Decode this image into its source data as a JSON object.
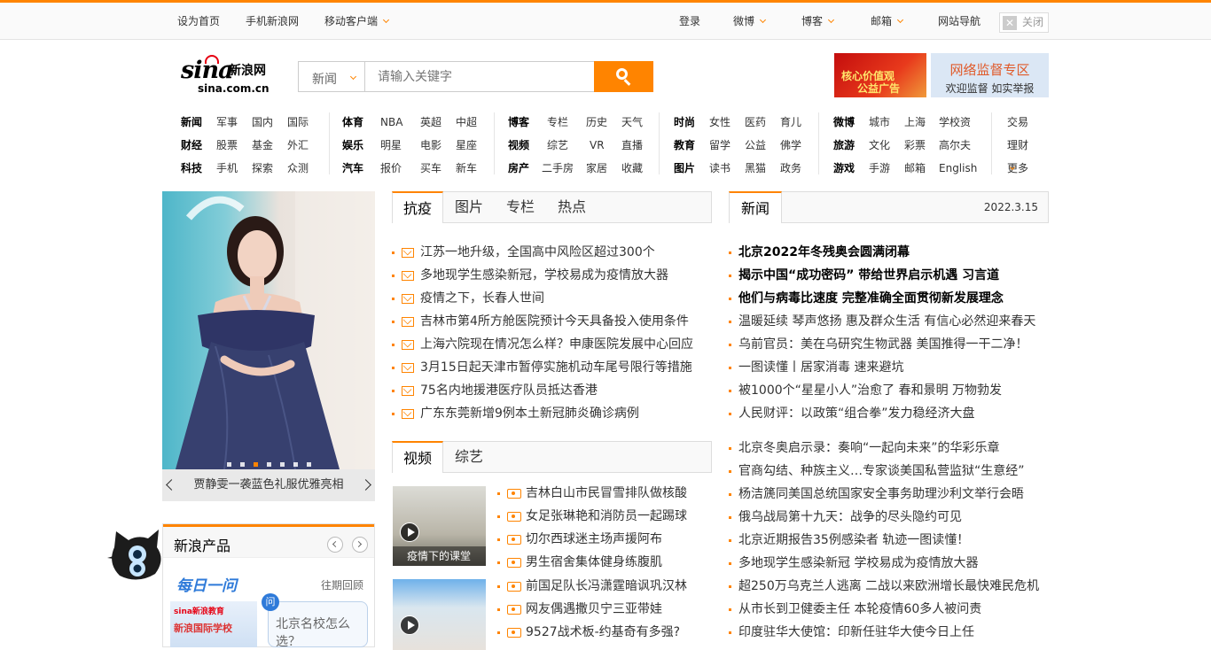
{
  "topbar": {
    "set_home": "设为首页",
    "mobile_sina": "手机新浪网",
    "mobile_client": "移动客户端",
    "login": "登录",
    "weibo": "微博",
    "blog": "博客",
    "mail": "邮箱",
    "site_nav": "网站导航",
    "close": "关闭"
  },
  "logo": {
    "brand": "sina",
    "cn": "新浪网",
    "domain": "sina.com.cn"
  },
  "search": {
    "category": "新闻",
    "placeholder": "请输入关键字"
  },
  "ads": {
    "left_line1": "核心价值观",
    "left_line2": "公益广告",
    "right_title": "网络监督专区",
    "right_sub": "欢迎监督 如实举报"
  },
  "nav": {
    "g1": [
      [
        "新闻",
        "军事",
        "国内",
        "国际"
      ],
      [
        "财经",
        "股票",
        "基金",
        "外汇"
      ],
      [
        "科技",
        "手机",
        "探索",
        "众测"
      ]
    ],
    "g2": [
      [
        "体育",
        "NBA",
        "英超",
        "中超"
      ],
      [
        "娱乐",
        "明星",
        "电影",
        "星座"
      ],
      [
        "汽车",
        "报价",
        "买车",
        "新车"
      ]
    ],
    "g3": [
      [
        "博客",
        "专栏",
        "历史",
        "天气"
      ],
      [
        "视频",
        "综艺",
        "VR",
        "直播"
      ],
      [
        "房产",
        "二手房",
        "家居",
        "收藏"
      ]
    ],
    "g4": [
      [
        "时尚",
        "女性",
        "医药",
        "育儿"
      ],
      [
        "教育",
        "留学",
        "公益",
        "佛学"
      ],
      [
        "图片",
        "读书",
        "黑猫",
        "政务"
      ]
    ],
    "g5": [
      [
        "微博",
        "城市",
        "上海",
        "学校资"
      ],
      [
        "旅游",
        "文化",
        "彩票",
        "高尔夫"
      ],
      [
        "游戏",
        "手游",
        "邮箱",
        "English"
      ]
    ],
    "g6": [
      "交易",
      "理财",
      "更多"
    ]
  },
  "slide": {
    "caption": "贾静雯一袭蓝色礼服优雅亮相"
  },
  "products": {
    "title": "新浪产品",
    "daily": "每日一问",
    "past": "往期回顾",
    "thumb_logo": "sina新浪教育",
    "thumb_title": "新浪国际学校",
    "question_badge": "问",
    "question": "北京名校怎么选？"
  },
  "tabs1": [
    "抗疫",
    "图片",
    "专栏",
    "热点"
  ],
  "news1": [
    "江苏一地升级，全国高中风险区超过300个",
    "多地现学生感染新冠，学校易成为疫情放大器",
    "疫情之下，长春人世间",
    "吉林市第4所方舱医院预计今天具备投入使用条件",
    "上海六院现在情况怎么样？申康医院发展中心回应",
    "3月15日起天津市暂停实施机动车尾号限行等措施",
    "75名内地援港医疗队员抵达香港",
    "广东东莞新增9例本土新冠肺炎确诊病例"
  ],
  "tabs2": [
    "视频",
    "综艺"
  ],
  "video_thumbs": [
    {
      "caption": "疫情下的课堂"
    },
    {
      "caption": ""
    }
  ],
  "videos": [
    "吉林白山市民冒雪排队做核酸",
    "女足张琳艳和消防员一起踢球",
    "切尔西球迷主场声援阿布",
    "男生宿舍集体健身练腹肌",
    "前国足队长冯潇霆暗讽巩汉林",
    "网友偶遇撒贝宁三亚带娃",
    "9527战术板-约基奇有多强?"
  ],
  "right": {
    "tab": "新闻",
    "date": "2022.3.15",
    "headlines": [
      "北京2022年冬残奥会圆满闭幕",
      "揭示中国“成功密码” 带给世界启示机遇 习言道",
      "他们与病毒比速度 完整准确全面贯彻新发展理念"
    ],
    "list1": [
      "温暖延续 琴声悠扬 惠及群众生活 有信心必然迎来春天",
      "乌前官员：美在乌研究生物武器 美国推得一干二净！",
      "一图读懂丨居家消毒 速来避坑",
      "被1000个“星星小人”治愈了 春和景明 万物勃发",
      "人民财评：以政策“组合拳”发力稳经济大盘"
    ],
    "list2": [
      "北京冬奥启示录：奏响“一起向未来”的华彩乐章",
      "官商勾结、种族主义…专家谈美国私营监狱“生意经”",
      "杨洁篪同美国总统国家安全事务助理沙利文举行会晤",
      "俄乌战局第十九天：战争的尽头隐约可见",
      "北京近期报告35例感染者 轨迹一图读懂！",
      "多地现学生感染新冠 学校易成为疫情放大器",
      "超250万乌克兰人逃离 二战以来欧洲增长最快难民危机",
      "从市长到卫健委主任 本轮疫情60多人被问责",
      "印度驻华大使馆：印新任驻华大使今日上任"
    ]
  },
  "colors": {
    "accent": "#ff8400",
    "link": "#333333",
    "blue": "#2e7ad9"
  }
}
